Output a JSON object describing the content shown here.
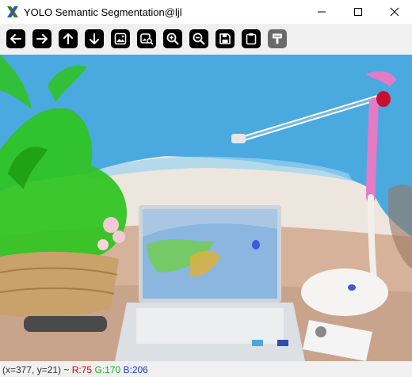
{
  "window": {
    "title": "YOLO Semantic Segmentation@ljl"
  },
  "window_controls": [
    "minimize-icon",
    "maximize-icon",
    "close-icon"
  ],
  "toolbar": {
    "buttons": [
      {
        "icon": "arrow-left-icon",
        "enabled": true
      },
      {
        "icon": "arrow-right-icon",
        "enabled": true
      },
      {
        "icon": "arrow-up-icon",
        "enabled": true
      },
      {
        "icon": "arrow-down-icon",
        "enabled": true
      },
      {
        "icon": "image-icon",
        "enabled": true
      },
      {
        "icon": "image-search-icon",
        "enabled": true
      },
      {
        "icon": "zoom-in-icon",
        "enabled": true
      },
      {
        "icon": "zoom-out-icon",
        "enabled": true
      },
      {
        "icon": "save-icon",
        "enabled": true
      },
      {
        "icon": "clipboard-icon",
        "enabled": true
      },
      {
        "icon": "paint-brush-icon",
        "enabled": false
      }
    ]
  },
  "colors": {
    "wall_mask": "#4aa9df",
    "plant_mask": "#2ec41f",
    "lamp_mask": "#e47bc6",
    "accent_red": "#e60000",
    "accent_green": "#19b319",
    "accent_blue": "#1a3de6"
  },
  "status": {
    "coords": "(x=377, y=21) ~",
    "r_label": "R:75",
    "g_label": "G:170",
    "b_label": "B:206"
  }
}
